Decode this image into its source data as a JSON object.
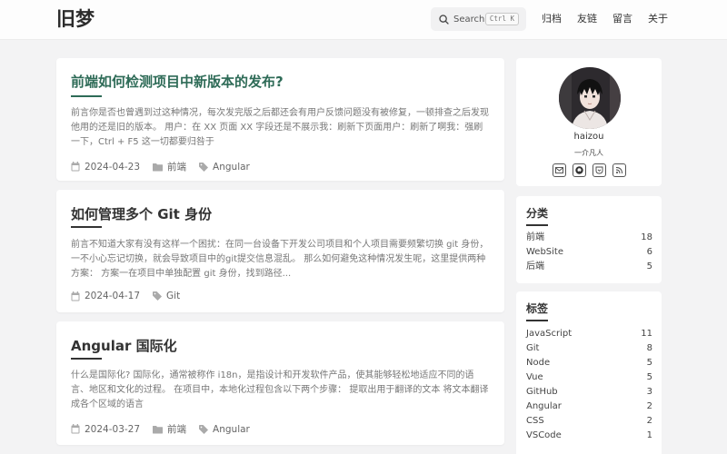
{
  "header": {
    "logo": "旧梦",
    "search": {
      "label": "Search",
      "shortcut": "Ctrl K"
    },
    "nav": [
      "归档",
      "友链",
      "留言",
      "关于"
    ]
  },
  "posts": [
    {
      "title": "前端如何检测项目中新版本的发布?",
      "excerpt": "前言你是否也曾遇到过这种情况，每次发完版之后都还会有用户反馈问题没有被修复，一顿排查之后发现他用的还是旧的版本。 用户：在 XX 页面 XX 字段还是不展示我：刷新下页面用户：刷新了啊我：强刷一下，Ctrl + F5 这一切都要归咎于",
      "date": "2024-04-23",
      "category": "前端",
      "tag": "Angular"
    },
    {
      "title": "如何管理多个 Git 身份",
      "excerpt": "前言不知道大家有没有这样一个困扰：在同一台设备下开发公司项目和个人项目需要频繁切换 git 身份，一不小心忘记切换，就会导致项目中的git提交信息混乱。 那么如何避免这种情况发生呢，这里提供两种方案： 方案一在项目中单独配置 git 身份，找到路径...",
      "date": "2024-04-17",
      "tag": "Git"
    },
    {
      "title": "Angular 国际化",
      "excerpt": "什么是国际化? 国际化，通常被称作 i18n，是指设计和开发软件产品，使其能够轻松地适应不同的语言、地区和文化的过程。 在项目中，本地化过程包含以下两个步骤： 提取出用于翻译的文本 将文本翻译成各个区域的语言",
      "date": "2024-03-27",
      "category": "前端",
      "tag": "Angular"
    }
  ],
  "profile": {
    "name": "haizou",
    "motto": "一介凡人",
    "icons": [
      "mail-icon",
      "github-icon",
      "bookmark-icon",
      "rss-icon"
    ]
  },
  "categories": {
    "heading": "分类",
    "items": [
      {
        "name": "前端",
        "count": "18"
      },
      {
        "name": "WebSite",
        "count": "6"
      },
      {
        "name": "后端",
        "count": "5"
      }
    ]
  },
  "tags": {
    "heading": "标签",
    "items": [
      {
        "name": "JavaScript",
        "count": "11"
      },
      {
        "name": "Git",
        "count": "8"
      },
      {
        "name": "Node",
        "count": "5"
      },
      {
        "name": "Vue",
        "count": "5"
      },
      {
        "name": "GitHub",
        "count": "3"
      },
      {
        "name": "Angular",
        "count": "2"
      },
      {
        "name": "CSS",
        "count": "2"
      },
      {
        "name": "VSCode",
        "count": "1"
      }
    ]
  },
  "colors": {
    "accent": "#2e6b57",
    "background": "#f3f3f4",
    "card": "#ffffff"
  }
}
